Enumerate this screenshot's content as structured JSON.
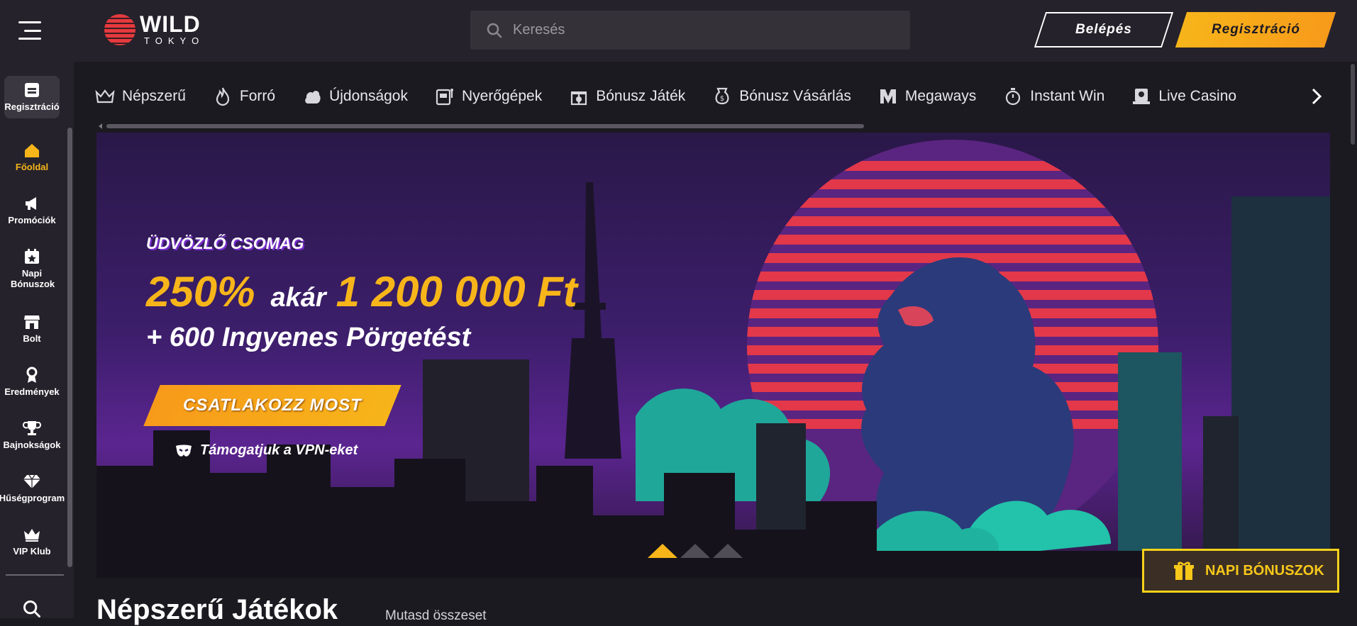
{
  "header": {
    "logo_wild": "WILD",
    "logo_tokyo": "TOKYO",
    "search_placeholder": "Keresés",
    "login_label": "Belépés",
    "register_label": "Regisztráció"
  },
  "sidebar": {
    "items": [
      {
        "label": "Regisztráció",
        "icon": "register-icon"
      },
      {
        "label": "Főoldal",
        "icon": "home-icon",
        "active": true
      },
      {
        "label": "Promóciók",
        "icon": "megaphone-icon"
      },
      {
        "label": "Napi Bónuszok",
        "icon": "calendar-star-icon"
      },
      {
        "label": "Bolt",
        "icon": "shop-icon"
      },
      {
        "label": "Eredmények",
        "icon": "medal-icon"
      },
      {
        "label": "Bajnokságok",
        "icon": "trophy-icon"
      },
      {
        "label": "Hűségprogram",
        "icon": "diamond-icon"
      },
      {
        "label": "VIP Klub",
        "icon": "crown-icon"
      }
    ]
  },
  "categories": [
    {
      "label": "Népszerű",
      "icon": "crown-icon"
    },
    {
      "label": "Forró",
      "icon": "flame-icon"
    },
    {
      "label": "Újdonságok",
      "icon": "new-icon"
    },
    {
      "label": "Nyerőgépek",
      "icon": "slot-machine-icon"
    },
    {
      "label": "Bónusz Játék",
      "icon": "gift-icon"
    },
    {
      "label": "Bónusz Vásárlás",
      "icon": "money-bag-icon"
    },
    {
      "label": "Megaways",
      "icon": "megaways-icon"
    },
    {
      "label": "Instant Win",
      "icon": "stopwatch-icon"
    },
    {
      "label": "Live Casino",
      "icon": "live-casino-icon"
    }
  ],
  "hero": {
    "eyebrow": "ÜDVÖZLŐ CSOMAG",
    "percent": "250%",
    "connector": "akár",
    "amount": "1 200 000 Ft",
    "subline": "+ 600 Ingyenes Pörgetést",
    "cta": "CSATLAKOZZ MOST",
    "vpn_text": "Támogatjuk a VPN-eket",
    "slide_count": 3,
    "active_slide": 1
  },
  "daily_bonus": {
    "label": "NAPI BÓNUSZOK"
  },
  "popular": {
    "title": "Népszerű Játékok",
    "link": "Mutasd összeset"
  },
  "colors": {
    "accent": "#f7b51a",
    "header_bg": "#25222b",
    "page_bg": "#1b1a20"
  }
}
